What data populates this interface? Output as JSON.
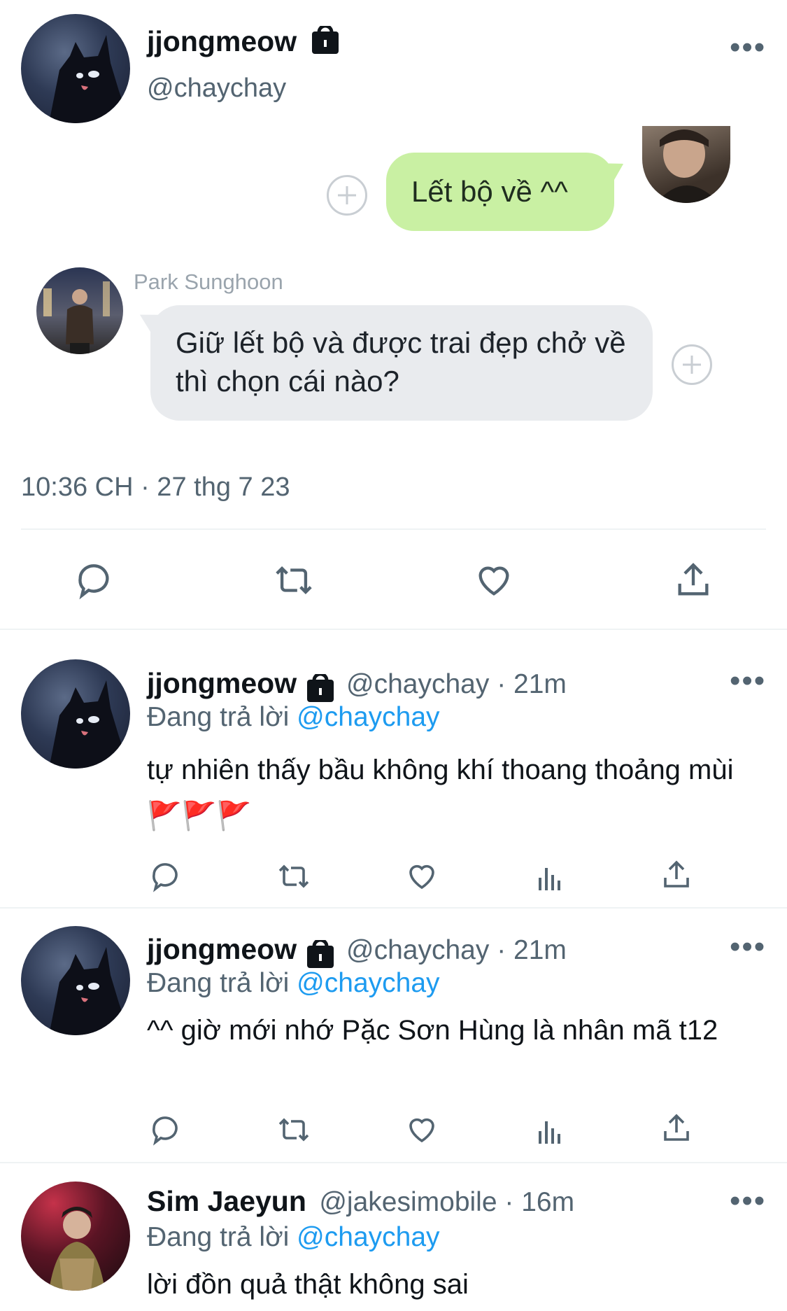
{
  "main_tweet": {
    "display_name": "jjongmeow",
    "handle": "@chaychay",
    "bubble_right": "Lết bộ về ^^",
    "chat_sender": "Park Sunghoon",
    "bubble_left": "Giữ lết bộ và được trai đẹp chở về thì chọn cái nào?",
    "timestamp": "10:36 CH · 27 thg 7 23"
  },
  "replying_label": "Đang trả lời",
  "replies": [
    {
      "display_name": "jjongmeow",
      "meta": "@chaychay · 21m",
      "reply_to": "@chaychay",
      "text": "tự nhiên thấy bầu không khí thoang thoảng mùi 🚩🚩🚩"
    },
    {
      "display_name": "jjongmeow",
      "meta": "@chaychay · 21m",
      "reply_to": "@chaychay",
      "text": "^^ giờ mới nhớ Pặc Sơn Hùng là nhân mã t12"
    },
    {
      "display_name": "Sim Jaeyun",
      "meta": "@jakesimobile · 16m",
      "reply_to": "@chaychay",
      "text": "lời đồn quả thật không sai"
    }
  ],
  "colors": {
    "bubble_right": "#c9f0a3",
    "bubble_left": "#e9ebee",
    "link": "#1d9bf0",
    "secondary_text": "#536471"
  },
  "icons": [
    "lock-icon",
    "more-icon",
    "reply-icon",
    "retweet-icon",
    "like-icon",
    "views-icon",
    "share-icon",
    "add-reaction-icon"
  ]
}
